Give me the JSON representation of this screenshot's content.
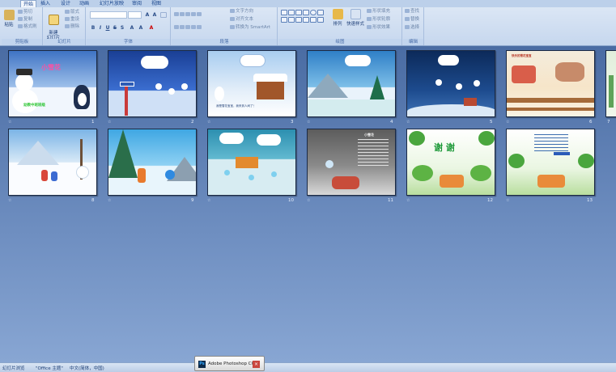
{
  "tabs": [
    "开始",
    "插入",
    "设计",
    "动画",
    "幻灯片放映",
    "审阅",
    "视图"
  ],
  "groups": {
    "clipboard": {
      "label": "剪贴板",
      "paste": "粘贴",
      "cut": "剪切",
      "copy": "复制",
      "format_painter": "格式刷"
    },
    "slides": {
      "label": "幻灯片",
      "new_slide": "新建\n幻灯片",
      "layout": "版式",
      "reset": "重设",
      "delete": "删除"
    },
    "font": {
      "label": "字体"
    },
    "paragraph": {
      "label": "段落",
      "text_direction": "文字方向",
      "align_text": "对齐文本",
      "smartart": "转换为 SmartArt"
    },
    "drawing": {
      "label": "绘图",
      "arrange": "排列",
      "quick_styles": "快速样式",
      "shape_fill": "形状填充",
      "shape_outline": "形状轮廓",
      "shape_effects": "形状效果"
    },
    "editing": {
      "label": "编辑",
      "find": "查找",
      "replace": "替换",
      "select": "选择"
    }
  },
  "slides": [
    {
      "number": "1",
      "title": "小雪花",
      "subtitle": "幼教中班班级"
    },
    {
      "number": "2"
    },
    {
      "number": "3",
      "caption": "我是雪花宝宝，我来到人间了！"
    },
    {
      "number": "4"
    },
    {
      "number": "5"
    },
    {
      "number": "6",
      "caption": "快乐的雪花宝宝"
    },
    {
      "number": "7"
    },
    {
      "number": "8"
    },
    {
      "number": "9"
    },
    {
      "number": "10"
    },
    {
      "number": "11",
      "title": "小雪花"
    },
    {
      "number": "12",
      "title": "谢 谢"
    },
    {
      "number": "13"
    }
  ],
  "status": {
    "view": "幻灯片浏览",
    "theme": "\"Office 主题\"",
    "language": "中文(简体，中国)"
  },
  "taskbar": {
    "app": "Adobe Photoshop CC"
  }
}
